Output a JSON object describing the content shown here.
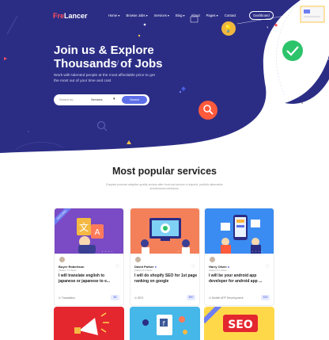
{
  "nav": {
    "logo_part1": "Fre",
    "logo_part2": "Lancer",
    "links": [
      "Home ▾",
      "Browse Jobs ▾",
      "Services ▾",
      "Blog ▾",
      "About",
      "Pages ▾",
      "Contact"
    ],
    "dashboard": "Dashboard"
  },
  "hero": {
    "title": "Join us & Explore Thousands of Jobs",
    "subtitle": "Work with talented people at the most affordable price to get the most out of your time and cost",
    "search_placeholder": "Search for...",
    "select_value": "Services",
    "search_button": "Search"
  },
  "services": {
    "title": "Most popular services",
    "subtitle": "Enquete promote adaptive quality vectors after front-end service or imports. portfolio alternative architectures interfaces.",
    "cards": [
      {
        "name": "Buyer Robertson",
        "meta": "(Seller) 7.0 Stars",
        "title": "I will translate english to japanese or japanese to e...",
        "category": "Translation",
        "price": "$5",
        "ribbon": "FEATURED"
      },
      {
        "name": "David Parker",
        "meta": "(Seller) 5.0 Stars",
        "title": "I will do shopify SEO for 1st page ranking on google",
        "category": "SEO",
        "price": "$50",
        "ribbon": ""
      },
      {
        "name": "Harry Olsen",
        "meta": "(Seller) 5.0 Stars",
        "title": "I will be your android app developer for android app ...",
        "category": "Mobile APP Development",
        "price": "$28",
        "ribbon": ""
      }
    ],
    "row2_seo_text": "SEO"
  },
  "colors": {
    "hero_bg": "#2b2d85",
    "accent": "#5d6fe8",
    "logo_accent": "#ff4f5a"
  }
}
